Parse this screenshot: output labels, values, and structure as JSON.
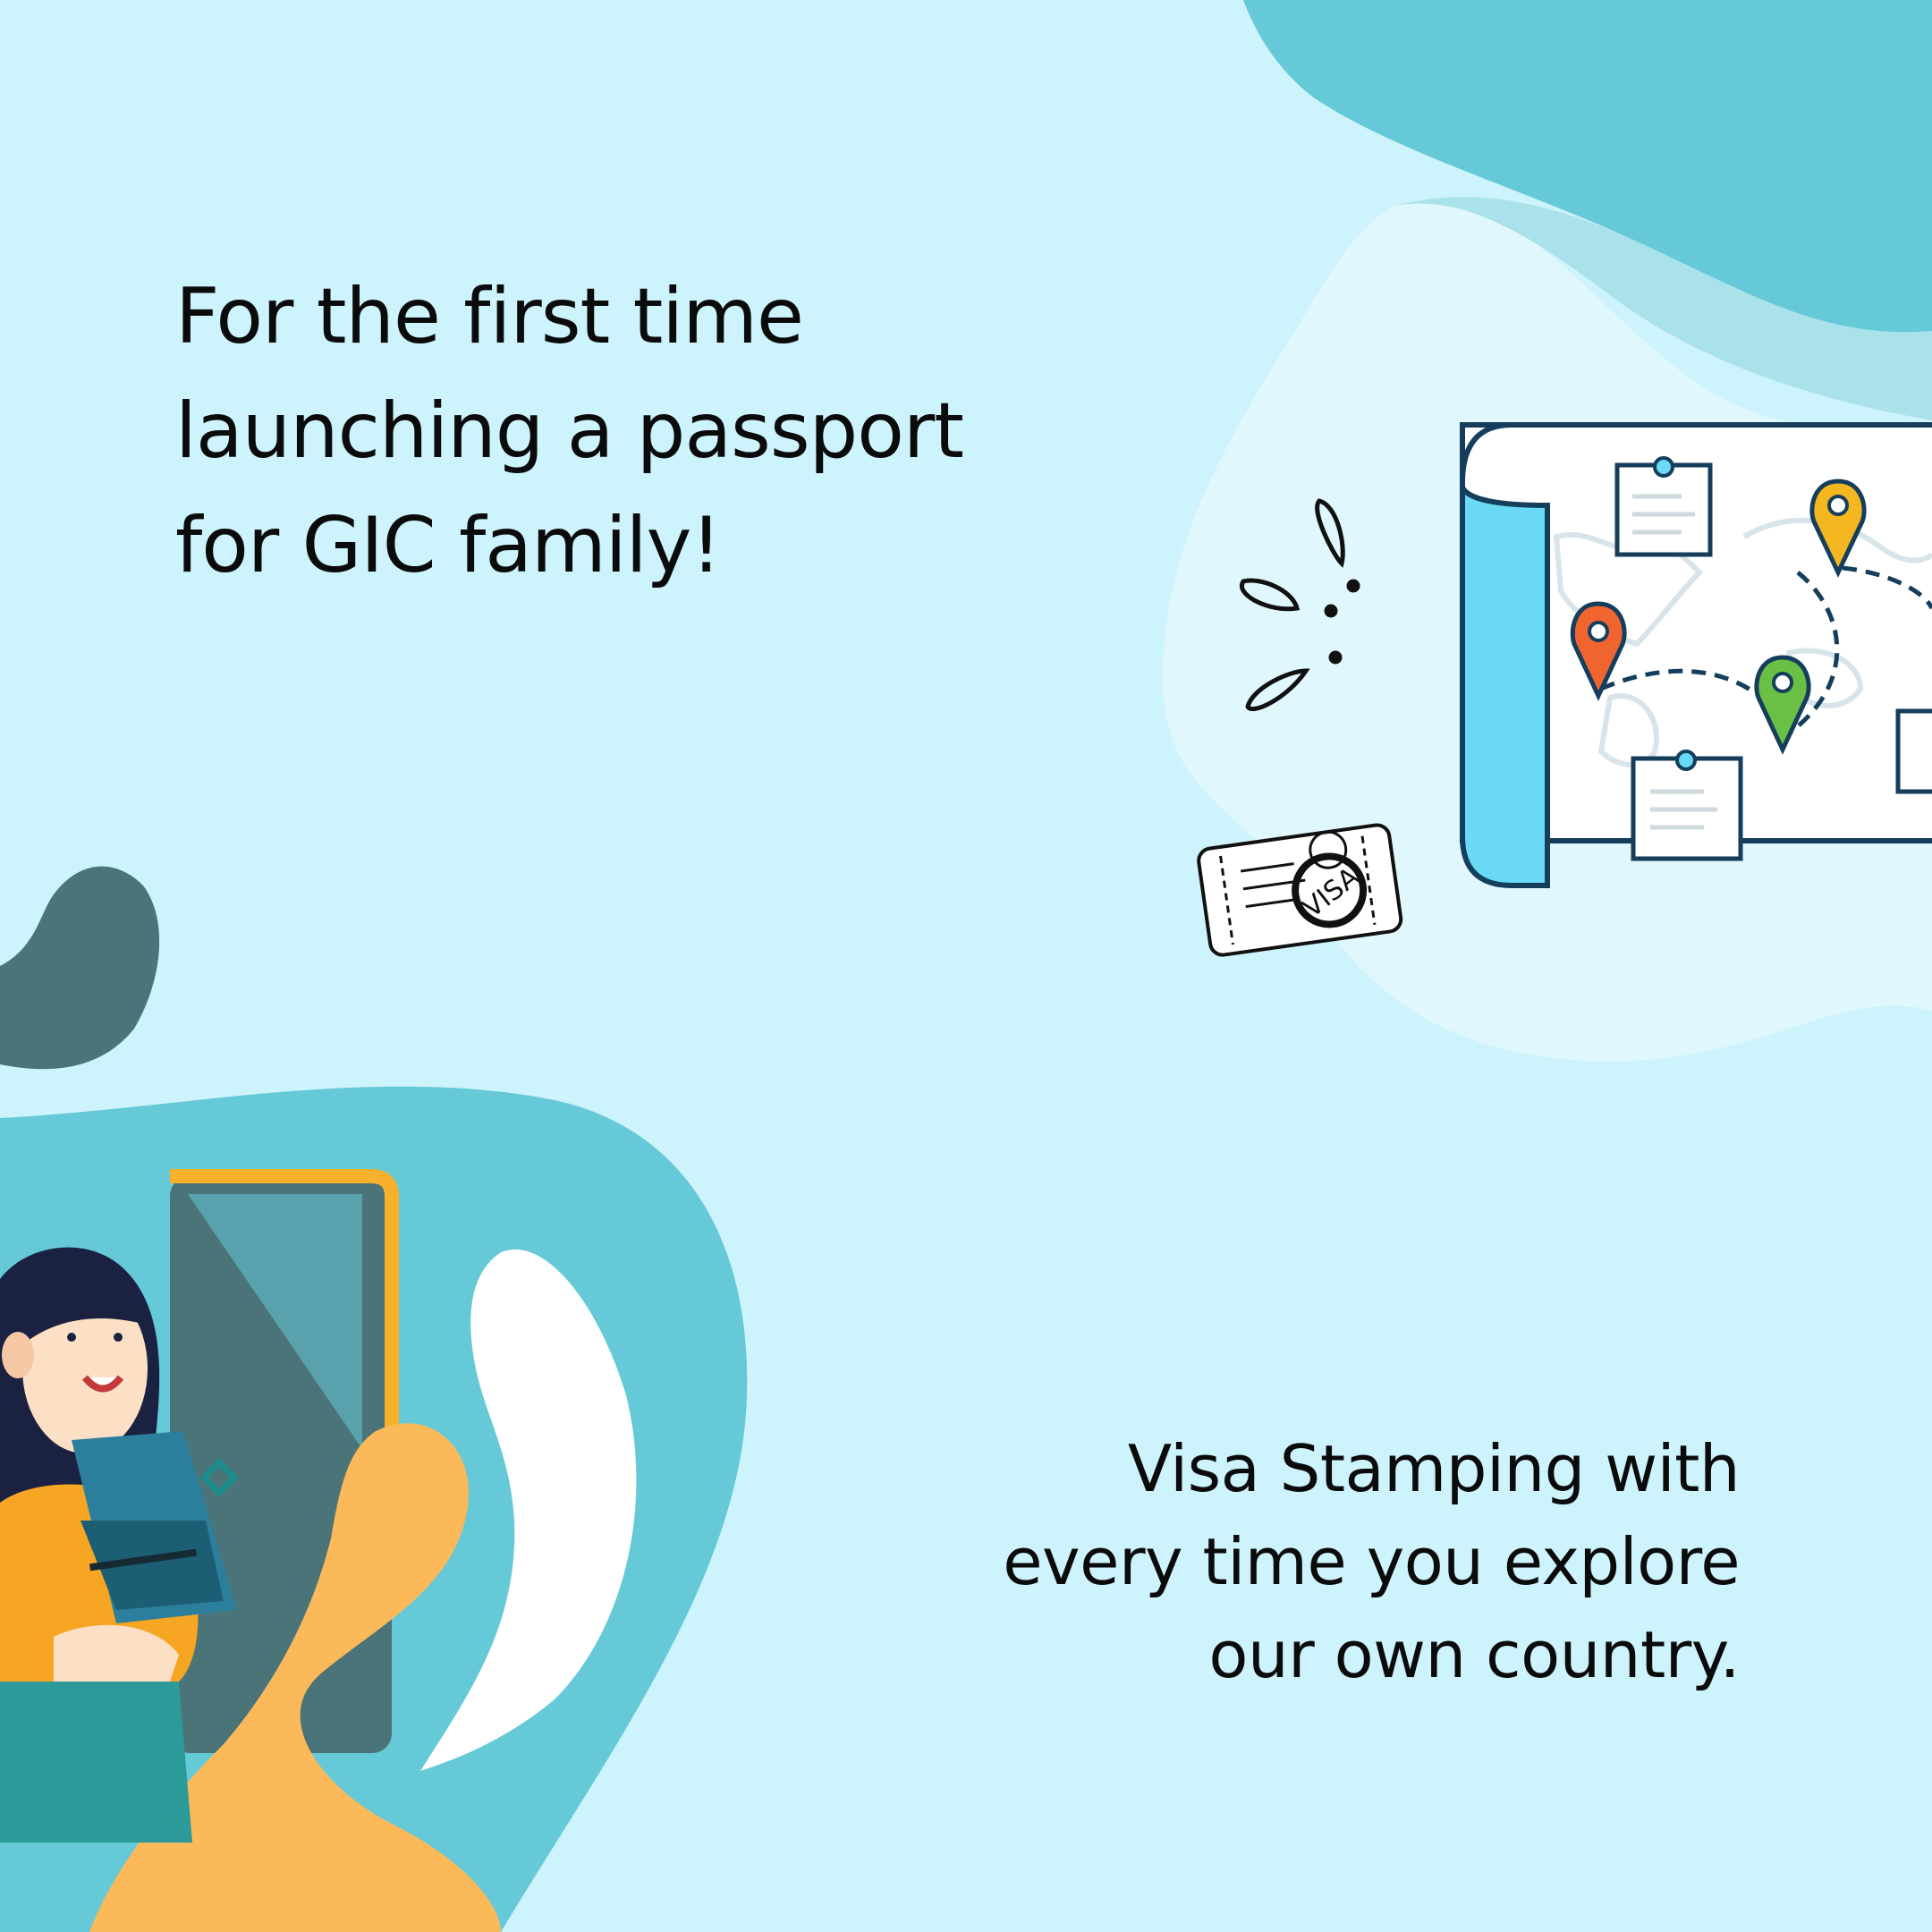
{
  "headline": {
    "lines": [
      "For the first time",
      "launching a passport",
      "for GIC family!"
    ]
  },
  "subline": {
    "lines": [
      "Visa Stamping with",
      "every time you explore",
      "our own country."
    ]
  },
  "visa_stamp_text": "VISA",
  "icons": [
    "map-icon",
    "location-pin-icon",
    "note-icon",
    "visa-ticket-icon",
    "exclamation-doodle-icon",
    "woman-with-passport-illustration",
    "phone-frame-icon"
  ],
  "colors": {
    "background": "#cdf3fc",
    "teal_blob": "#66c9d8",
    "dark_teal": "#4b7478",
    "orange": "#fbb95a",
    "map_blue": "#6ad9f5",
    "outline": "#153e5c",
    "pin_orange": "#f06430",
    "pin_yellow": "#f5b720",
    "pin_green": "#6abf45"
  }
}
